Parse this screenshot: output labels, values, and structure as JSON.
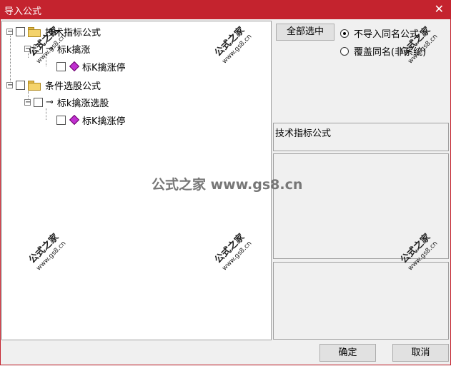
{
  "window": {
    "title": "导入公式",
    "close_label": "✕"
  },
  "tree": [
    {
      "label": "技术指标公式",
      "type": "folder",
      "level": 0
    },
    {
      "label": "标k擒涨",
      "type": "key",
      "level": 1
    },
    {
      "label": "标K擒涨停",
      "type": "gem",
      "level": 2
    },
    {
      "label": "条件选股公式",
      "type": "folder",
      "level": 0
    },
    {
      "label": "标k擒涨选股",
      "type": "key",
      "level": 1
    },
    {
      "label": "标K擒涨停",
      "type": "gem",
      "level": 2
    }
  ],
  "buttons": {
    "select_all": "全部选中",
    "ok": "确定",
    "cancel": "取消"
  },
  "options": [
    {
      "label": "不导入同名公式",
      "checked": true
    },
    {
      "label": "覆盖同名(非系统)",
      "checked": false
    }
  ],
  "description": {
    "text": "技术指标公式"
  },
  "watermark": {
    "main": "公式之家 www.gs8.cn",
    "brand": "公式之家",
    "url": "www.gs8.cn"
  }
}
